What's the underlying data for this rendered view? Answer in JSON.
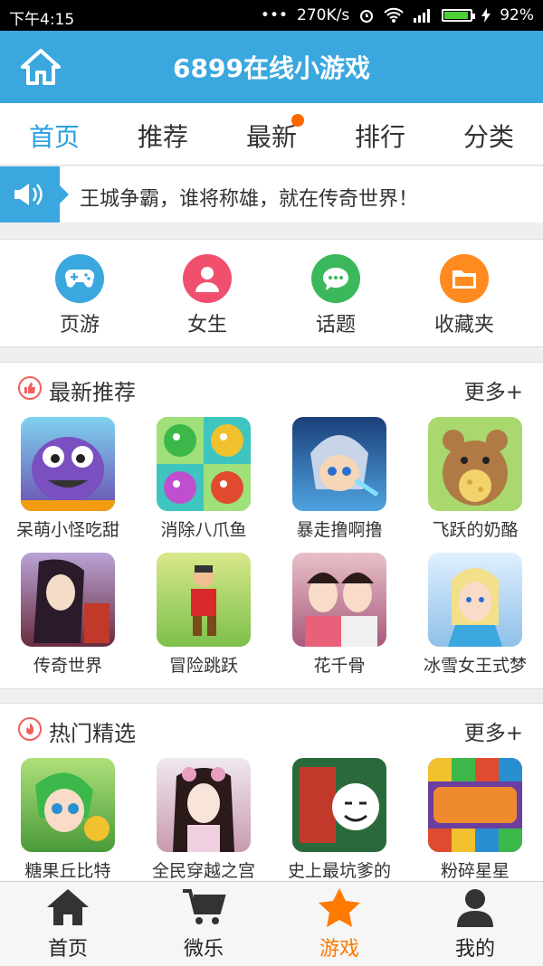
{
  "status_bar": {
    "time": "下午4:15",
    "dots": "•••",
    "speed": "270K/s",
    "battery": "92%",
    "battery_level": 0.92,
    "icons": [
      "alarm-icon",
      "wifi-icon",
      "signal-icon",
      "battery-icon",
      "charging-icon"
    ]
  },
  "header": {
    "title": "6899在线小游戏",
    "home_icon": "home-icon"
  },
  "tabs": [
    {
      "label": "首页",
      "active": true
    },
    {
      "label": "推荐",
      "active": false
    },
    {
      "label": "最新",
      "active": false,
      "badge": true
    },
    {
      "label": "排行",
      "active": false
    },
    {
      "label": "分类",
      "active": false
    }
  ],
  "announcement": {
    "icon": "speaker-icon",
    "text": "王城争霸，谁将称雄，就在传奇世界！"
  },
  "quick_links": [
    {
      "label": "页游",
      "icon": "gamepad-icon",
      "color": "#3aa7df"
    },
    {
      "label": "女生",
      "icon": "person-icon",
      "color": "#f0506e"
    },
    {
      "label": "话题",
      "icon": "chat-icon",
      "color": "#3cb85c"
    },
    {
      "label": "收藏夹",
      "icon": "folder-icon",
      "color": "#ff8a1f"
    }
  ],
  "latest": {
    "title": "最新推荐",
    "more": "更多+",
    "icon": "thumbs-up-icon",
    "games": [
      {
        "name": "呆萌小怪吃甜",
        "color": "#6a4fb0"
      },
      {
        "name": "消除八爪鱼",
        "color": "#4caf50"
      },
      {
        "name": "暴走撸啊撸",
        "color": "#2d6fb3"
      },
      {
        "name": "飞跃的奶酪",
        "color": "#a0743d"
      },
      {
        "name": "传奇世界",
        "color": "#8e3b5a"
      },
      {
        "name": "冒险跳跃",
        "color": "#7cc04a"
      },
      {
        "name": "花千骨",
        "color": "#c85a7c"
      },
      {
        "name": "冰雪女王式梦",
        "color": "#9fc6e8"
      }
    ]
  },
  "hot": {
    "title": "热门精选",
    "more": "更多+",
    "icon": "flame-icon",
    "games": [
      {
        "name": "糖果丘比特",
        "color": "#5cb85c"
      },
      {
        "name": "全民穿越之宫",
        "color": "#c89ab0"
      },
      {
        "name": "史上最坑爹的",
        "color": "#c0392b"
      },
      {
        "name": "粉碎星星",
        "color": "#9b59b6"
      }
    ]
  },
  "bottom_nav": [
    {
      "label": "首页",
      "icon": "home-icon",
      "active": false
    },
    {
      "label": "微乐",
      "icon": "cart-icon",
      "active": false
    },
    {
      "label": "游戏",
      "icon": "star-icon",
      "active": true
    },
    {
      "label": "我的",
      "icon": "user-icon",
      "active": false
    }
  ],
  "colors": {
    "primary": "#3aa7df",
    "accent": "#ff7a00",
    "text": "#333333"
  }
}
